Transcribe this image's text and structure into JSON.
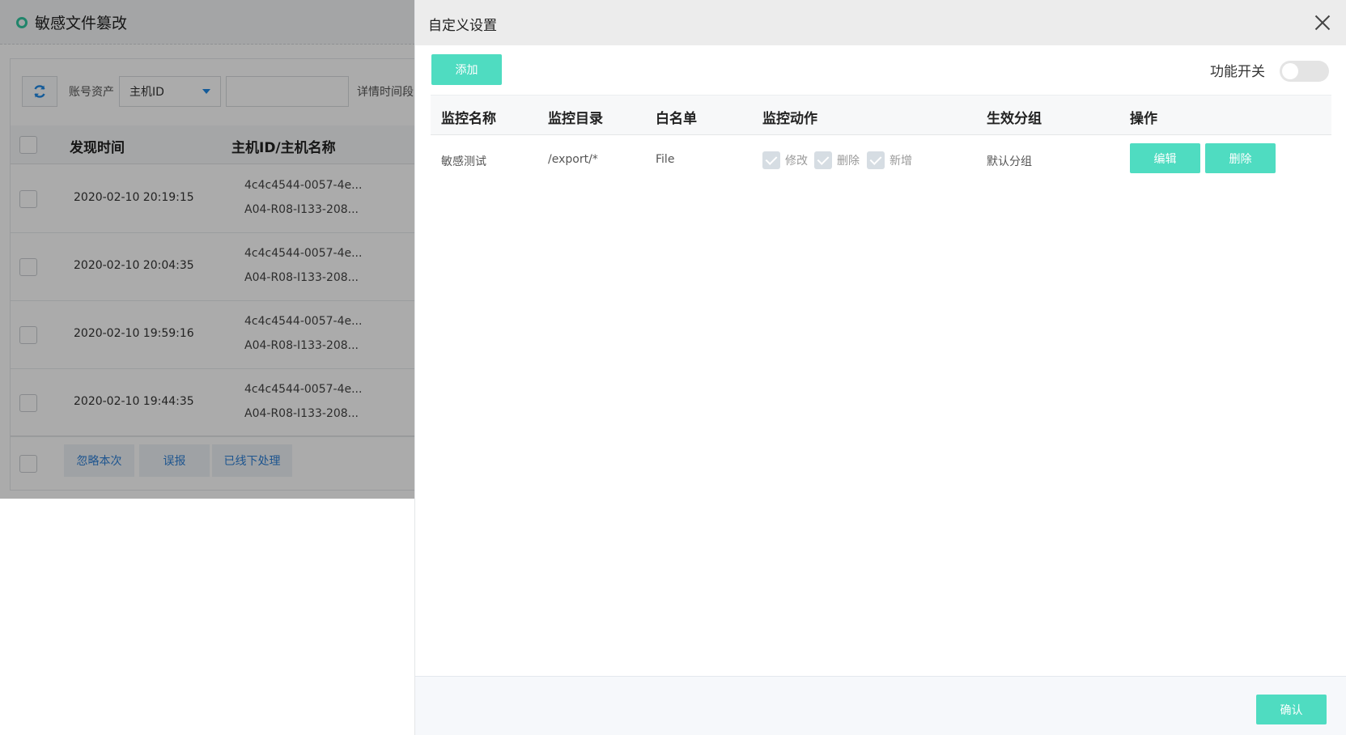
{
  "background": {
    "title": "敏感文件篡改",
    "toolbar": {
      "account_label": "账号资产",
      "select_value": "主机ID",
      "input_value": "",
      "detail_label": "详情时间段"
    },
    "table": {
      "columns": [
        "发现时间",
        "主机ID/主机名称"
      ],
      "rows": [
        {
          "time": "2020-02-10 20:19:15",
          "host_id": "4c4c4544-0057-4e...",
          "host_name": "A04-R08-I133-208..."
        },
        {
          "time": "2020-02-10 20:04:35",
          "host_id": "4c4c4544-0057-4e...",
          "host_name": "A04-R08-I133-208..."
        },
        {
          "time": "2020-02-10 19:59:16",
          "host_id": "4c4c4544-0057-4e...",
          "host_name": "A04-R08-I133-208..."
        },
        {
          "time": "2020-02-10 19:44:35",
          "host_id": "4c4c4544-0057-4e...",
          "host_name": "A04-R08-I133-208..."
        }
      ]
    },
    "footer_buttons": [
      "忽略本次",
      "误报",
      "已线下处理"
    ]
  },
  "drawer": {
    "title": "自定义设置",
    "add_label": "添加",
    "switch_label": "功能开关",
    "switch_on": false,
    "columns": [
      "监控名称",
      "监控目录",
      "白名单",
      "监控动作",
      "生效分组",
      "操作"
    ],
    "rows": [
      {
        "name": "敏感测试",
        "directory": "/export/*",
        "whitelist": "File",
        "actions": [
          "修改",
          "删除",
          "新增"
        ],
        "group": "默认分组",
        "edit_label": "编辑",
        "delete_label": "删除"
      }
    ],
    "confirm_label": "确认"
  },
  "colors": {
    "accent": "#4fdcc1",
    "status_dot": "#32c7a0",
    "link_blue": "#2d7fd6"
  }
}
